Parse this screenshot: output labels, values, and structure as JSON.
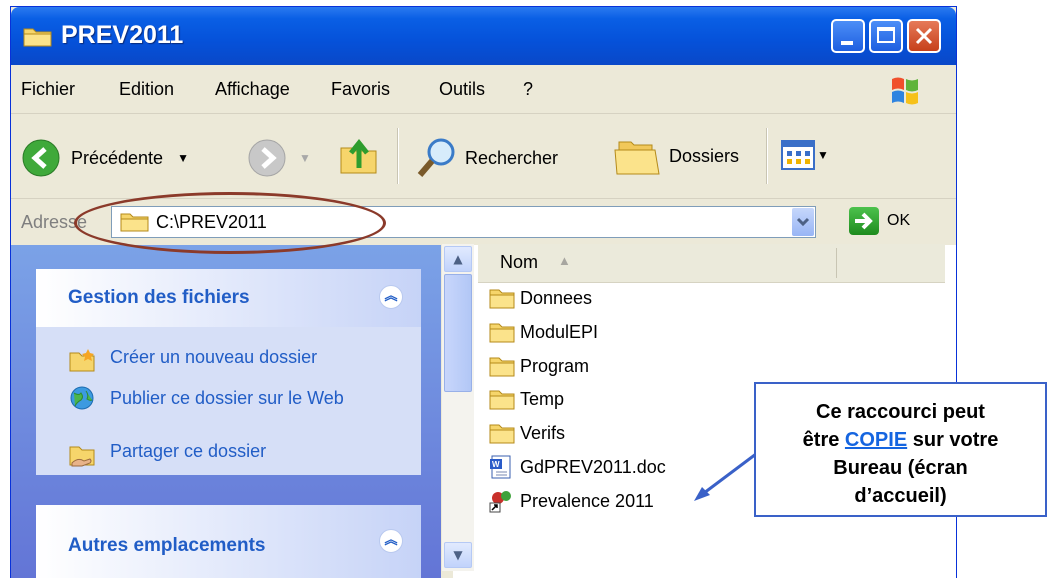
{
  "window": {
    "title": "PREV2011"
  },
  "menu": [
    "Fichier",
    "Edition",
    "Affichage",
    "Favoris",
    "Outils",
    "?"
  ],
  "toolbar": {
    "back": "Précédente",
    "search": "Rechercher",
    "folders": "Dossiers"
  },
  "address": {
    "label": "Adresse",
    "path": "C:\\PREV2011",
    "go": "OK"
  },
  "tasks": {
    "file_tasks_title": "Gestion des fichiers",
    "items": [
      "Créer un nouveau dossier",
      "Publier ce dossier sur le Web",
      "Partager ce dossier"
    ],
    "other_places_title": "Autres emplacements"
  },
  "files": {
    "column_name": "Nom",
    "items": [
      {
        "name": "Donnees",
        "icon": "folder-icon"
      },
      {
        "name": "ModulEPI",
        "icon": "folder-icon"
      },
      {
        "name": "Program",
        "icon": "folder-icon"
      },
      {
        "name": "Temp",
        "icon": "folder-icon"
      },
      {
        "name": "Verifs",
        "icon": "folder-icon"
      },
      {
        "name": "GdPREV2011.doc",
        "icon": "word-doc-icon"
      },
      {
        "name": "Prevalence 2011",
        "icon": "shortcut-icon"
      }
    ]
  },
  "callout": {
    "line1": "Ce raccourci peut",
    "line2_pre": "être",
    "line2_link": "COPIE",
    "line2_post": "sur votre",
    "line3": "Bureau (écran",
    "line4": "d’accueil)"
  },
  "colors": {
    "title_blue": "#0551D9",
    "task_blue": "#215DC6",
    "callout_border": "#3A61C8",
    "ellipse": "#8B3A2A"
  }
}
